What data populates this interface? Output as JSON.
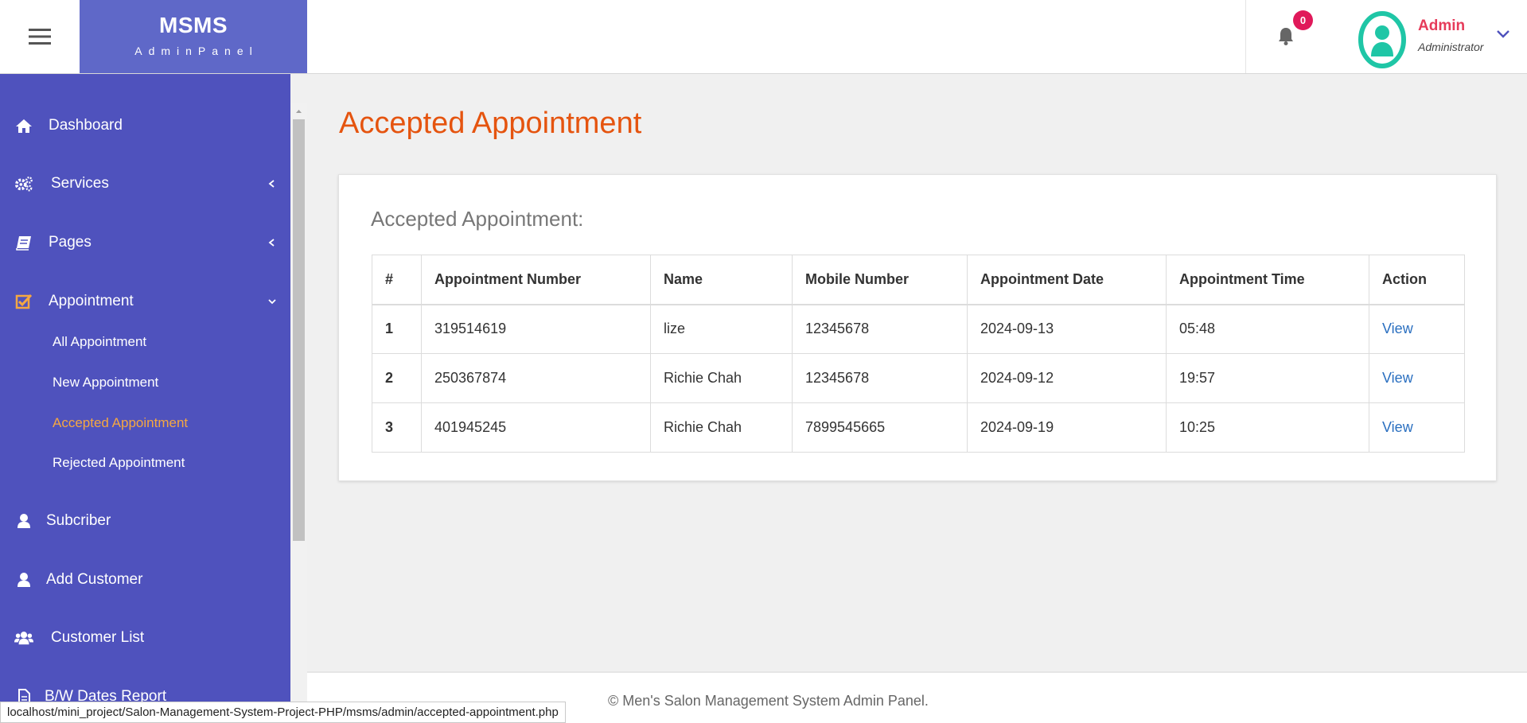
{
  "brand": {
    "name": "MSMS",
    "sub": "AdminPanel"
  },
  "header": {
    "notification_count": "0",
    "user_name": "Admin",
    "user_role": "Administrator"
  },
  "sidebar": {
    "items": [
      {
        "label": "Dashboard",
        "icon": "home-icon"
      },
      {
        "label": "Services",
        "icon": "gears-icon"
      },
      {
        "label": "Pages",
        "icon": "book-icon"
      },
      {
        "label": "Appointment",
        "icon": "checkbox-icon"
      },
      {
        "label": "Subcriber",
        "icon": "user-icon"
      },
      {
        "label": "Add Customer",
        "icon": "user-icon"
      },
      {
        "label": "Customer List",
        "icon": "users-icon"
      },
      {
        "label": "B/W Dates Report",
        "icon": "file-icon"
      }
    ],
    "appointment_sub": [
      "All Appointment",
      "New Appointment",
      "Accepted Appointment",
      "Rejected Appointment"
    ]
  },
  "main": {
    "title": "Accepted Appointment",
    "card_title": "Accepted Appointment:",
    "columns": [
      "#",
      "Appointment Number",
      "Name",
      "Mobile Number",
      "Appointment Date",
      "Appointment Time",
      "Action"
    ],
    "rows": [
      [
        "1",
        "319514619",
        "lize",
        "12345678",
        "2024-09-13",
        "05:48",
        "View"
      ],
      [
        "2",
        "250367874",
        "Richie Chah",
        "12345678",
        "2024-09-12",
        "19:57",
        "View"
      ],
      [
        "3",
        "401945245",
        "Richie Chah",
        "7899545665",
        "2024-09-19",
        "10:25",
        "View"
      ]
    ]
  },
  "footer": {
    "text": "© Men's Salon Management System Admin Panel."
  },
  "status_url": "localhost/mini_project/Salon-Management-System-Project-PHP/msms/admin/accepted-appointment.php",
  "colors": {
    "sidebar": "#4f52bd",
    "brand": "#5f68c8",
    "title": "#e5540f",
    "active": "#f5a742",
    "link": "#2a6fc0",
    "badge": "#e0195a",
    "avatar": "#1fc6a6"
  }
}
